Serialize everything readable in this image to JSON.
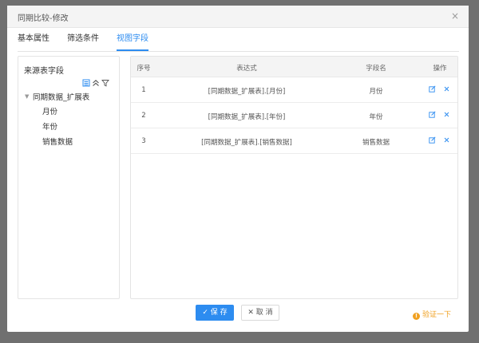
{
  "dialog": {
    "title": "同期比较-修改",
    "close_glyph": "×"
  },
  "tabs": [
    {
      "label": "基本属性",
      "active": false
    },
    {
      "label": "筛选条件",
      "active": false
    },
    {
      "label": "视图字段",
      "active": true
    }
  ],
  "source_panel": {
    "title": "来源表字段",
    "tree": {
      "root": "同期数据_扩展表",
      "children": [
        "月份",
        "年份",
        "销售数据"
      ]
    }
  },
  "grid": {
    "columns": [
      "序号",
      "表达式",
      "字段名",
      "操作"
    ],
    "rows": [
      {
        "index": "1",
        "expression": "[同期数据_扩展表].[月份]",
        "field": "月份"
      },
      {
        "index": "2",
        "expression": "[同期数据_扩展表].[年份]",
        "field": "年份"
      },
      {
        "index": "3",
        "expression": "[同期数据_扩展表].[销售数据]",
        "field": "销售数据"
      }
    ]
  },
  "footer": {
    "save_label": "✓ 保 存",
    "cancel_label": "✕ 取 消",
    "verify_label": "验证一下"
  },
  "colors": {
    "accent": "#2d8cf0",
    "warning": "#f0a020",
    "backdrop": "#707070"
  }
}
